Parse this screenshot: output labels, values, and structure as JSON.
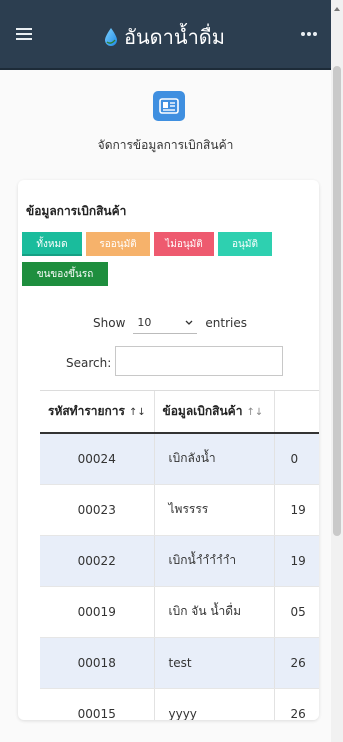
{
  "header": {
    "brand": "อันดาน้ำดื่ม",
    "menu_icon": "hamburger-icon",
    "more_icon": "more-dots-icon",
    "logo_icon": "water-drop-icon"
  },
  "page": {
    "title": "จัดการข้อมูลการเบิกสินค้า",
    "hero_icon": "id-card-icon"
  },
  "card": {
    "title": "ข้อมูลการเบิกสินค้า",
    "filters": [
      {
        "label": "ทั้งหมด",
        "color": "#1abc9c"
      },
      {
        "label": "รออนุมัติ",
        "color": "#f6b26b"
      },
      {
        "label": "ไม่อนุมัติ",
        "color": "#ee5a6f"
      },
      {
        "label": "อนุมัติ",
        "color": "#2ed0b0"
      },
      {
        "label": "ขนของขึ้นรถ",
        "color": "#1e8e3e"
      }
    ],
    "show_label": "Show",
    "entries_value": "10",
    "entries_label": "entries",
    "search_label": "Search:",
    "search_value": ""
  },
  "table": {
    "columns": [
      "รหัสทำรายการ",
      "ข้อมูลเบิกสินค้า",
      ""
    ],
    "rows": [
      {
        "code": "00024",
        "desc": "เบิกลังน้ำ",
        "date": "0"
      },
      {
        "code": "00023",
        "desc": "ไพรรรร",
        "date": "19"
      },
      {
        "code": "00022",
        "desc": "เบิกน้ำำำำำำ",
        "date": "19"
      },
      {
        "code": "00019",
        "desc": "เบิก จัน น้ำดื่ม",
        "date": "05"
      },
      {
        "code": "00018",
        "desc": "test",
        "date": "26"
      },
      {
        "code": "00015",
        "desc": "yyyy",
        "date": "26"
      }
    ]
  }
}
